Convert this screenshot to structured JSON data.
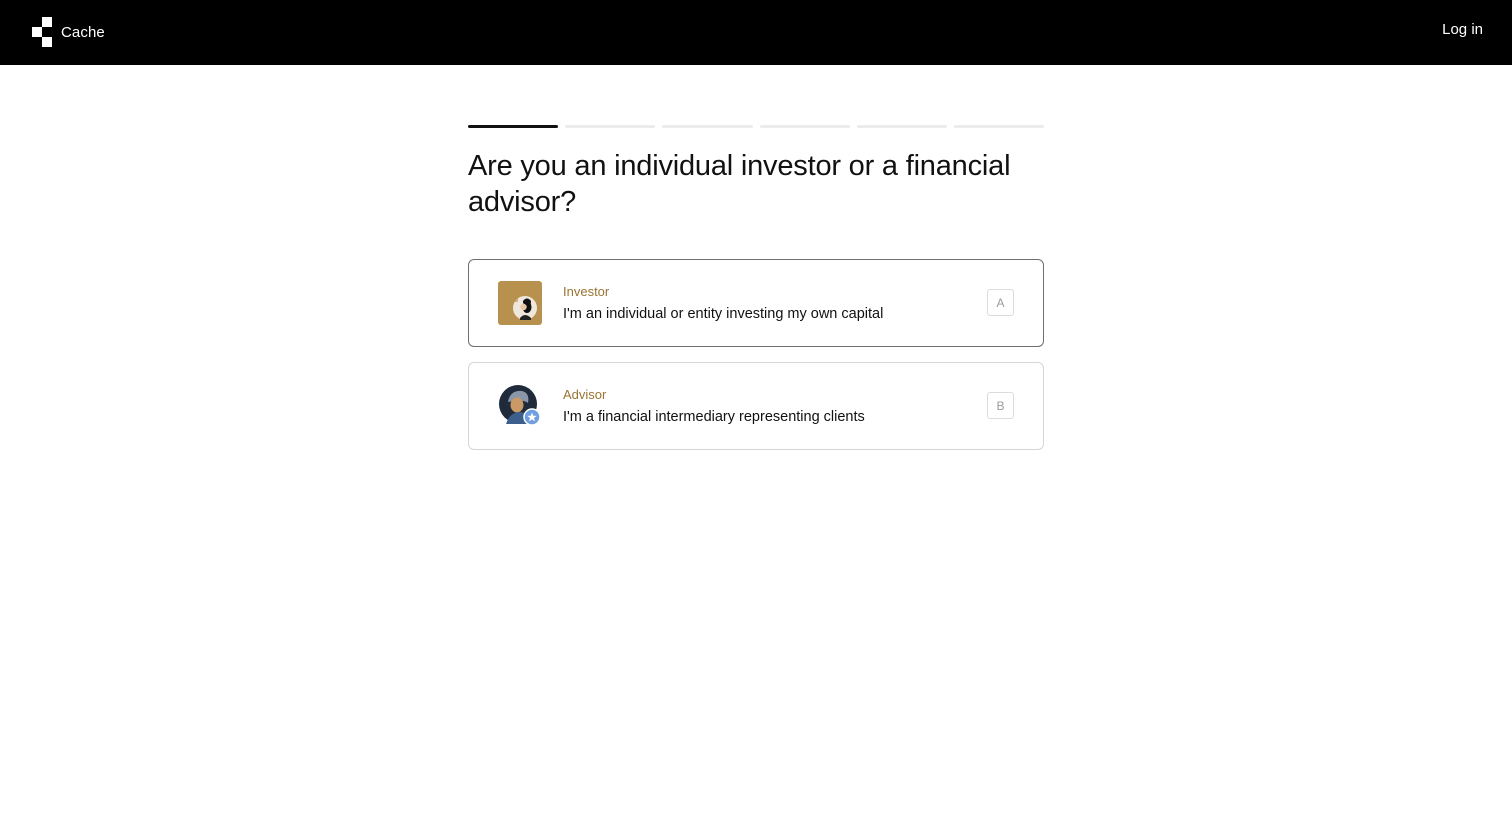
{
  "header": {
    "brand_name": "Cache",
    "login_label": "Log in"
  },
  "progress": {
    "total_steps": 6,
    "current_step": 1
  },
  "question": "Are you an individual investor or a financial advisor?",
  "options": [
    {
      "title": "Investor",
      "description": "I'm an individual or entity investing my own capital",
      "key": "A",
      "selected": true,
      "avatar_icon": "investor-avatar-icon"
    },
    {
      "title": "Advisor",
      "description": "I'm a financial intermediary representing clients",
      "key": "B",
      "selected": false,
      "avatar_icon": "advisor-avatar-icon"
    }
  ],
  "colors": {
    "header_bg": "#000000",
    "accent_gold": "#9a7433",
    "investor_tile": "#b8914f",
    "advisor_badge": "#6f9fe0"
  }
}
